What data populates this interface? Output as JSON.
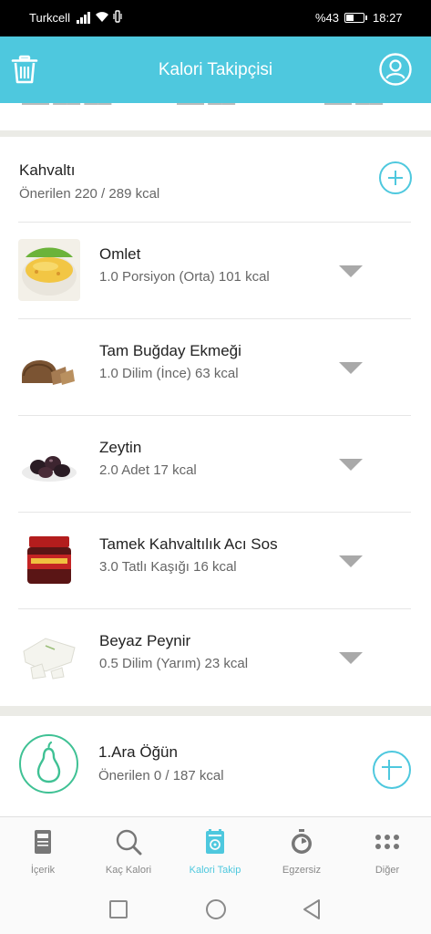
{
  "status_bar": {
    "carrier": "Turkcell",
    "battery_percent": "%43",
    "time": "18:27",
    "icons": [
      "signal-icon",
      "wifi-icon",
      "vibrate-icon",
      "battery-icon"
    ]
  },
  "header": {
    "title": "Kalori Takipçisi",
    "left_icon": "trash-icon",
    "right_icon": "profile-icon"
  },
  "meals": {
    "breakfast": {
      "title": "Kahvaltı",
      "recommended": "Önerilen 220 / 289 kcal",
      "items": [
        {
          "name": "Omlet",
          "detail": "1.0 Porsiyon (Orta) 101 kcal"
        },
        {
          "name": "Tam Buğday Ekmeği",
          "detail": "1.0 Dilim (İnce) 63 kcal"
        },
        {
          "name": "Zeytin",
          "detail": "2.0 Adet 17 kcal"
        },
        {
          "name": "Tamek Kahvaltılık Acı Sos",
          "detail": "3.0 Tatlı Kaşığı 16 kcal"
        },
        {
          "name": "Beyaz Peynir",
          "detail": "0.5 Dilim (Yarım) 23 kcal"
        }
      ]
    },
    "snack1": {
      "title": "1.Ara Öğün",
      "recommended": "Önerilen 0 / 187 kcal",
      "icon": "pear-icon"
    }
  },
  "bottom_nav": {
    "tabs": [
      {
        "label": "İçerik",
        "icon": "book-icon",
        "active": false
      },
      {
        "label": "Kaç Kalori",
        "icon": "search-icon",
        "active": false
      },
      {
        "label": "Kalori Takip",
        "icon": "calorie-tracker-icon",
        "active": true
      },
      {
        "label": "Egzersiz",
        "icon": "stopwatch-icon",
        "active": false
      },
      {
        "label": "Diğer",
        "icon": "more-dots-icon",
        "active": false
      }
    ]
  },
  "colors": {
    "accent": "#4ec8de",
    "pear_green": "#3fc194",
    "chevron": "#a9a9a9"
  }
}
